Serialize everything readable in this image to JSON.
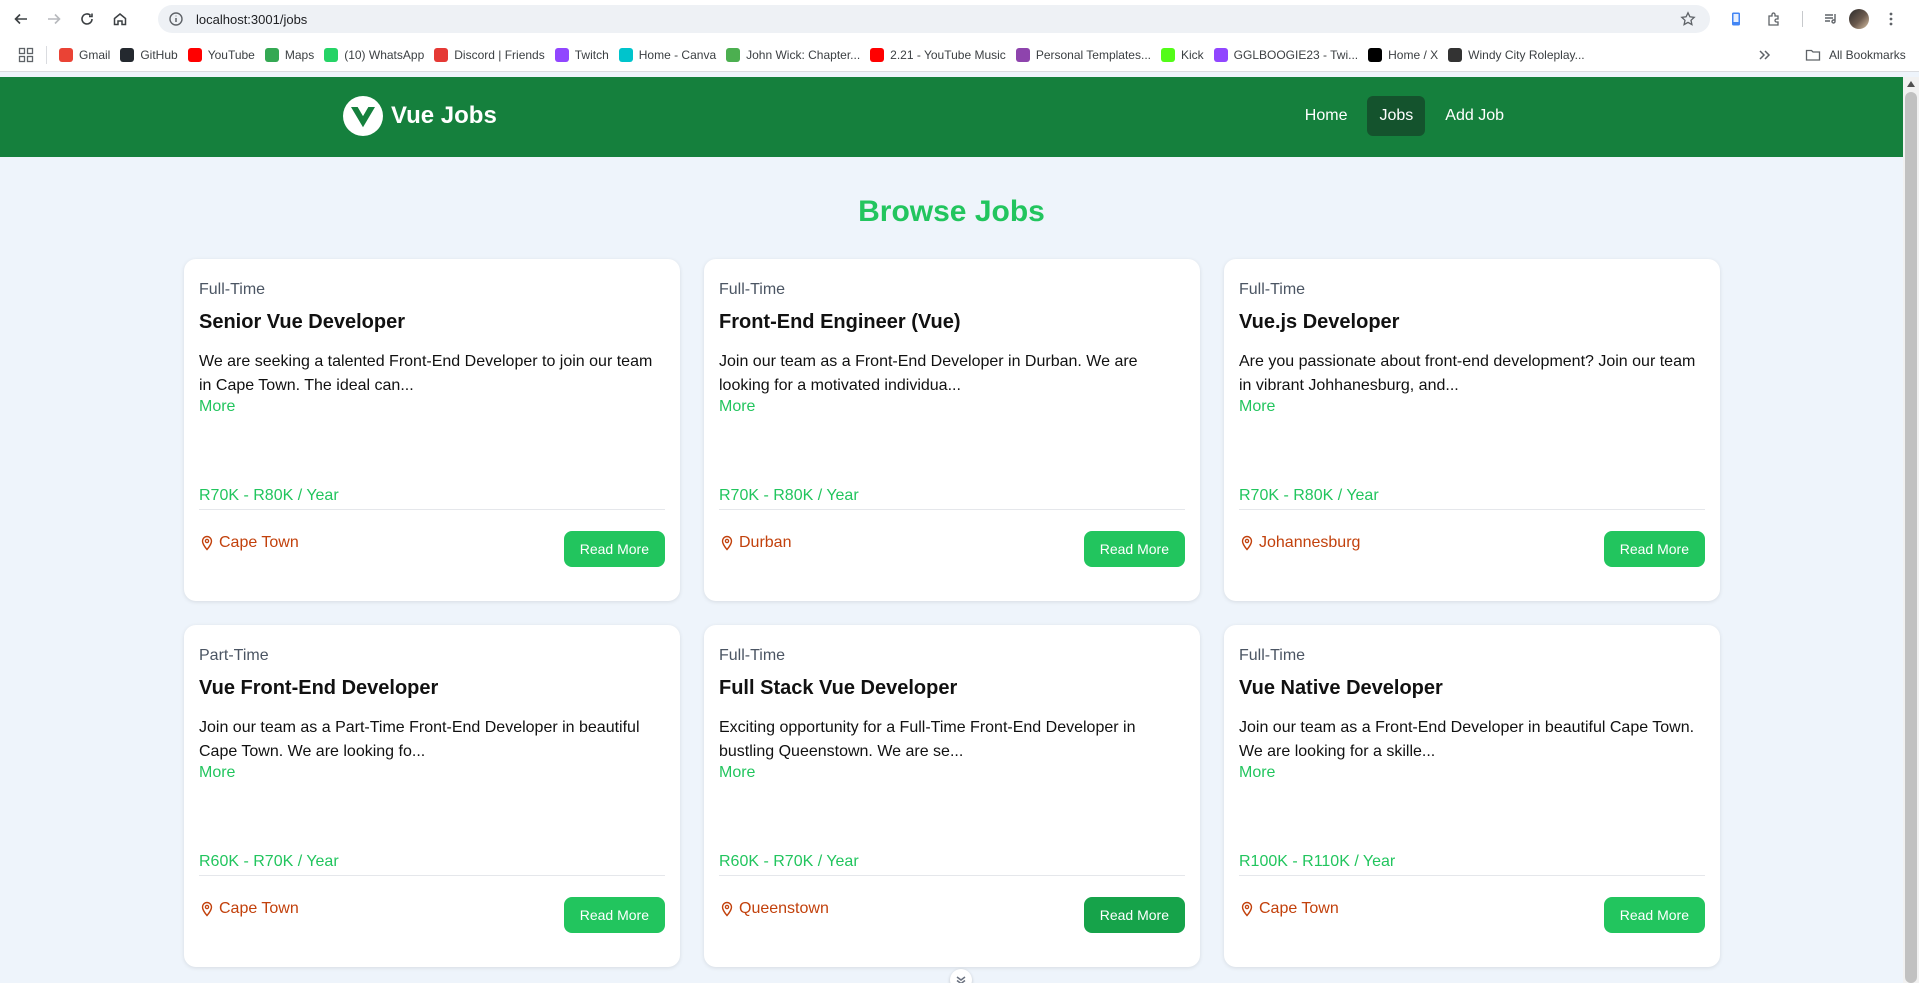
{
  "browser": {
    "url": "localhost:3001/jobs",
    "bookmarks": [
      {
        "label": "Gmail",
        "icon": "gmail-icon",
        "color": "#ea4335"
      },
      {
        "label": "GitHub",
        "icon": "github-icon",
        "color": "#24292f"
      },
      {
        "label": "YouTube",
        "icon": "youtube-icon",
        "color": "#ff0000"
      },
      {
        "label": "Maps",
        "icon": "maps-icon",
        "color": "#34a853"
      },
      {
        "label": "(10) WhatsApp",
        "icon": "whatsapp-icon",
        "color": "#25d366"
      },
      {
        "label": "Discord | Friends",
        "icon": "discord-icon",
        "color": "#e53935"
      },
      {
        "label": "Twitch",
        "icon": "twitch-icon",
        "color": "#9146ff"
      },
      {
        "label": "Home - Canva",
        "icon": "canva-icon",
        "color": "#00c4cc"
      },
      {
        "label": "John Wick: Chapter...",
        "icon": "movie-site-icon",
        "color": "#4caf50"
      },
      {
        "label": "2.21 - YouTube Music",
        "icon": "youtube-music-icon",
        "color": "#ff0000"
      },
      {
        "label": "Personal Templates...",
        "icon": "templates-icon",
        "color": "#8e44ad"
      },
      {
        "label": "Kick",
        "icon": "kick-icon",
        "color": "#53fc18"
      },
      {
        "label": "GGLBOOGIE23 - Twi...",
        "icon": "twitch-icon",
        "color": "#9146ff"
      },
      {
        "label": "Home / X",
        "icon": "x-icon",
        "color": "#000000"
      },
      {
        "label": "Windy City Roleplay...",
        "icon": "roleplay-icon",
        "color": "#333333"
      }
    ],
    "all_bookmarks_label": "All Bookmarks"
  },
  "app": {
    "brand": "Vue Jobs",
    "nav": {
      "home": "Home",
      "jobs": "Jobs",
      "add_job": "Add Job"
    },
    "page_title": "Browse Jobs",
    "more_label": "More",
    "read_more_label": "Read More",
    "colors": {
      "nav_bg": "#15803d",
      "accent": "#22c55e",
      "location": "#c2410c"
    },
    "jobs": [
      {
        "type": "Full-Time",
        "title": "Senior Vue Developer",
        "description": "We are seeking a talented Front-End Developer to join our team in Cape Town. The ideal can...",
        "salary": "R70K - R80K / Year",
        "location": "Cape Town"
      },
      {
        "type": "Full-Time",
        "title": "Front-End Engineer (Vue)",
        "description": "Join our team as a Front-End Developer in Durban. We are looking for a motivated individua...",
        "salary": "R70K - R80K / Year",
        "location": "Durban"
      },
      {
        "type": "Full-Time",
        "title": "Vue.js Developer",
        "description": "Are you passionate about front-end development? Join our team in vibrant Johhanesburg, and...",
        "salary": "R70K - R80K / Year",
        "location": "Johannesburg"
      },
      {
        "type": "Part-Time",
        "title": "Vue Front-End Developer",
        "description": "Join our team as a Part-Time Front-End Developer in beautiful Cape Town. We are looking fo...",
        "salary": "R60K - R70K / Year",
        "location": "Cape Town"
      },
      {
        "type": "Full-Time",
        "title": "Full Stack Vue Developer",
        "description": "Exciting opportunity for a Full-Time Front-End Developer in bustling Queenstown. We are se...",
        "salary": "R60K - R70K / Year",
        "location": "Queenstown"
      },
      {
        "type": "Full-Time",
        "title": "Vue Native Developer",
        "description": "Join our team as a Front-End Developer in beautiful Cape Town. We are looking for a skille...",
        "salary": "R100K - R110K / Year",
        "location": "Cape Town"
      }
    ]
  }
}
